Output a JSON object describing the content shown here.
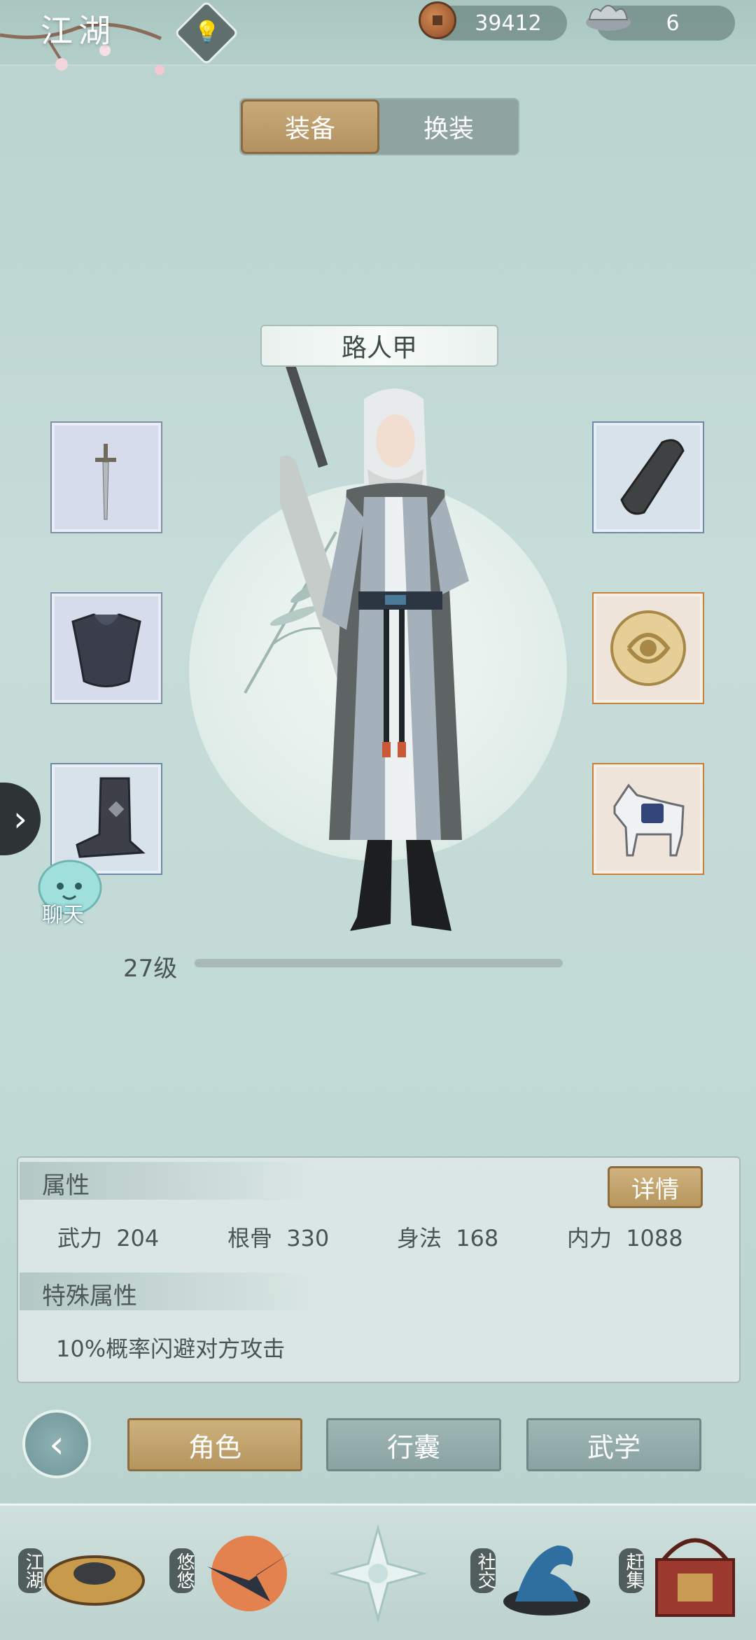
{
  "header": {
    "region_title": "江湖",
    "copper_amount": "39412",
    "silver_amount": "6"
  },
  "tabs": [
    {
      "label": "装备",
      "active": true
    },
    {
      "label": "换装",
      "active": false
    }
  ],
  "character": {
    "name": "路人甲",
    "level_label": "27级",
    "xp_progress": 0.0
  },
  "equipment": {
    "left": [
      "sword-icon",
      "armor-icon",
      "boots-icon"
    ],
    "right": [
      "bracer-icon",
      "jade-pendant-icon",
      "horse-icon"
    ]
  },
  "chat": {
    "label": "聊天"
  },
  "attributes": {
    "title": "属性",
    "detail_button": "详情",
    "stats": [
      {
        "name": "武力",
        "value": "204"
      },
      {
        "name": "根骨",
        "value": "330"
      },
      {
        "name": "身法",
        "value": "168"
      },
      {
        "name": "内力",
        "value": "1088"
      }
    ],
    "special_title": "特殊属性",
    "special_text": "10%概率闪避对方攻击"
  },
  "bottom_nav": {
    "buttons": [
      {
        "label": "角色",
        "active": true
      },
      {
        "label": "行囊",
        "active": false
      },
      {
        "label": "武学",
        "active": false
      }
    ]
  },
  "dock": [
    {
      "label": "江湖"
    },
    {
      "label": "悠悠"
    },
    {
      "label": ""
    },
    {
      "label": "社交"
    },
    {
      "label": "赶集"
    }
  ],
  "colors": {
    "gold_accent": "#b8975f",
    "teal_background": "#c6dcd8",
    "slot_purple": "#d6dcec",
    "slot_orange_border": "#c8803c"
  }
}
